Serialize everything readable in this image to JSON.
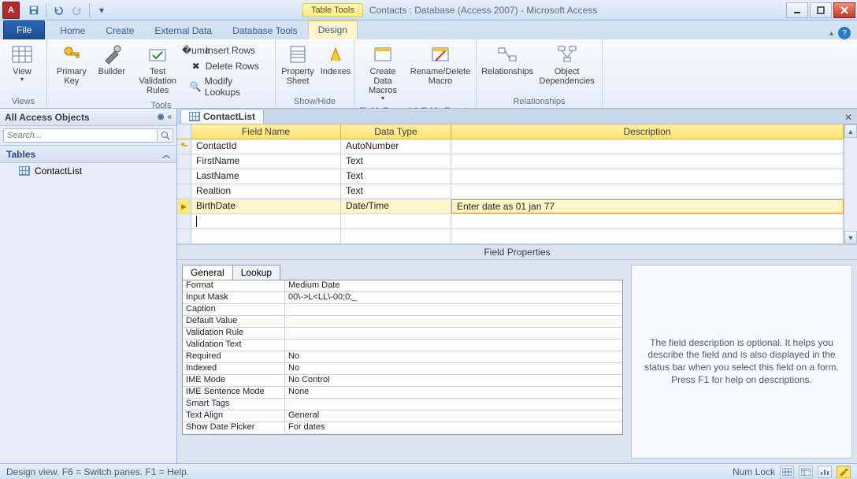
{
  "titlebar": {
    "app_icon_letter": "A",
    "table_tools": "Table Tools",
    "title": "Contacts : Database (Access 2007)  -  Microsoft Access"
  },
  "ribbon_tabs": {
    "file": "File",
    "home": "Home",
    "create": "Create",
    "external_data": "External Data",
    "database_tools": "Database Tools",
    "design": "Design"
  },
  "ribbon": {
    "views": {
      "view": "View",
      "group": "Views"
    },
    "tools": {
      "primary_key": "Primary Key",
      "builder": "Builder",
      "test_validation": "Test Validation Rules",
      "insert_rows": "Insert Rows",
      "delete_rows": "Delete Rows",
      "modify_lookups": "Modify Lookups",
      "group": "Tools"
    },
    "showhide": {
      "property_sheet": "Property Sheet",
      "indexes": "Indexes",
      "group": "Show/Hide"
    },
    "events": {
      "create_data_macros": "Create Data Macros",
      "rename_delete_macro": "Rename/Delete Macro",
      "group": "Field, Record & Table Events"
    },
    "relationships": {
      "relationships": "Relationships",
      "object_dependencies": "Object Dependencies",
      "group": "Relationships"
    }
  },
  "navpane": {
    "header": "All Access Objects",
    "search_placeholder": "Search...",
    "tables_label": "Tables",
    "items": [
      "ContactList"
    ]
  },
  "document": {
    "tab_name": "ContactList"
  },
  "design_grid": {
    "headers": {
      "field_name": "Field Name",
      "data_type": "Data Type",
      "description": "Description"
    },
    "rows": [
      {
        "key": true,
        "field": "ContactId",
        "type": "AutoNumber",
        "desc": ""
      },
      {
        "key": false,
        "field": "FirstName",
        "type": "Text",
        "desc": ""
      },
      {
        "key": false,
        "field": "LastName",
        "type": "Text",
        "desc": ""
      },
      {
        "key": false,
        "field": "Realtion",
        "type": "Text",
        "desc": ""
      },
      {
        "key": false,
        "field": "BirthDate",
        "type": "Date/Time",
        "desc": "Enter date as 01 jan 77",
        "selected": true
      }
    ],
    "selected_index": 4
  },
  "field_properties": {
    "title": "Field Properties",
    "tabs": {
      "general": "General",
      "lookup": "Lookup"
    },
    "props": [
      {
        "label": "Format",
        "value": "Medium Date"
      },
      {
        "label": "Input Mask",
        "value": "00\\->L<LL\\-00;0;_"
      },
      {
        "label": "Caption",
        "value": ""
      },
      {
        "label": "Default Value",
        "value": ""
      },
      {
        "label": "Validation Rule",
        "value": ""
      },
      {
        "label": "Validation Text",
        "value": ""
      },
      {
        "label": "Required",
        "value": "No"
      },
      {
        "label": "Indexed",
        "value": "No"
      },
      {
        "label": "IME Mode",
        "value": "No Control"
      },
      {
        "label": "IME Sentence Mode",
        "value": "None"
      },
      {
        "label": "Smart Tags",
        "value": ""
      },
      {
        "label": "Text Align",
        "value": "General"
      },
      {
        "label": "Show Date Picker",
        "value": "For dates"
      }
    ],
    "help_text": "The field description is optional. It helps you describe the field and is also displayed in the status bar when you select this field on a form. Press F1 for help on descriptions."
  },
  "statusbar": {
    "left": "Design view.  F6 = Switch panes.  F1 = Help.",
    "numlock": "Num Lock"
  }
}
